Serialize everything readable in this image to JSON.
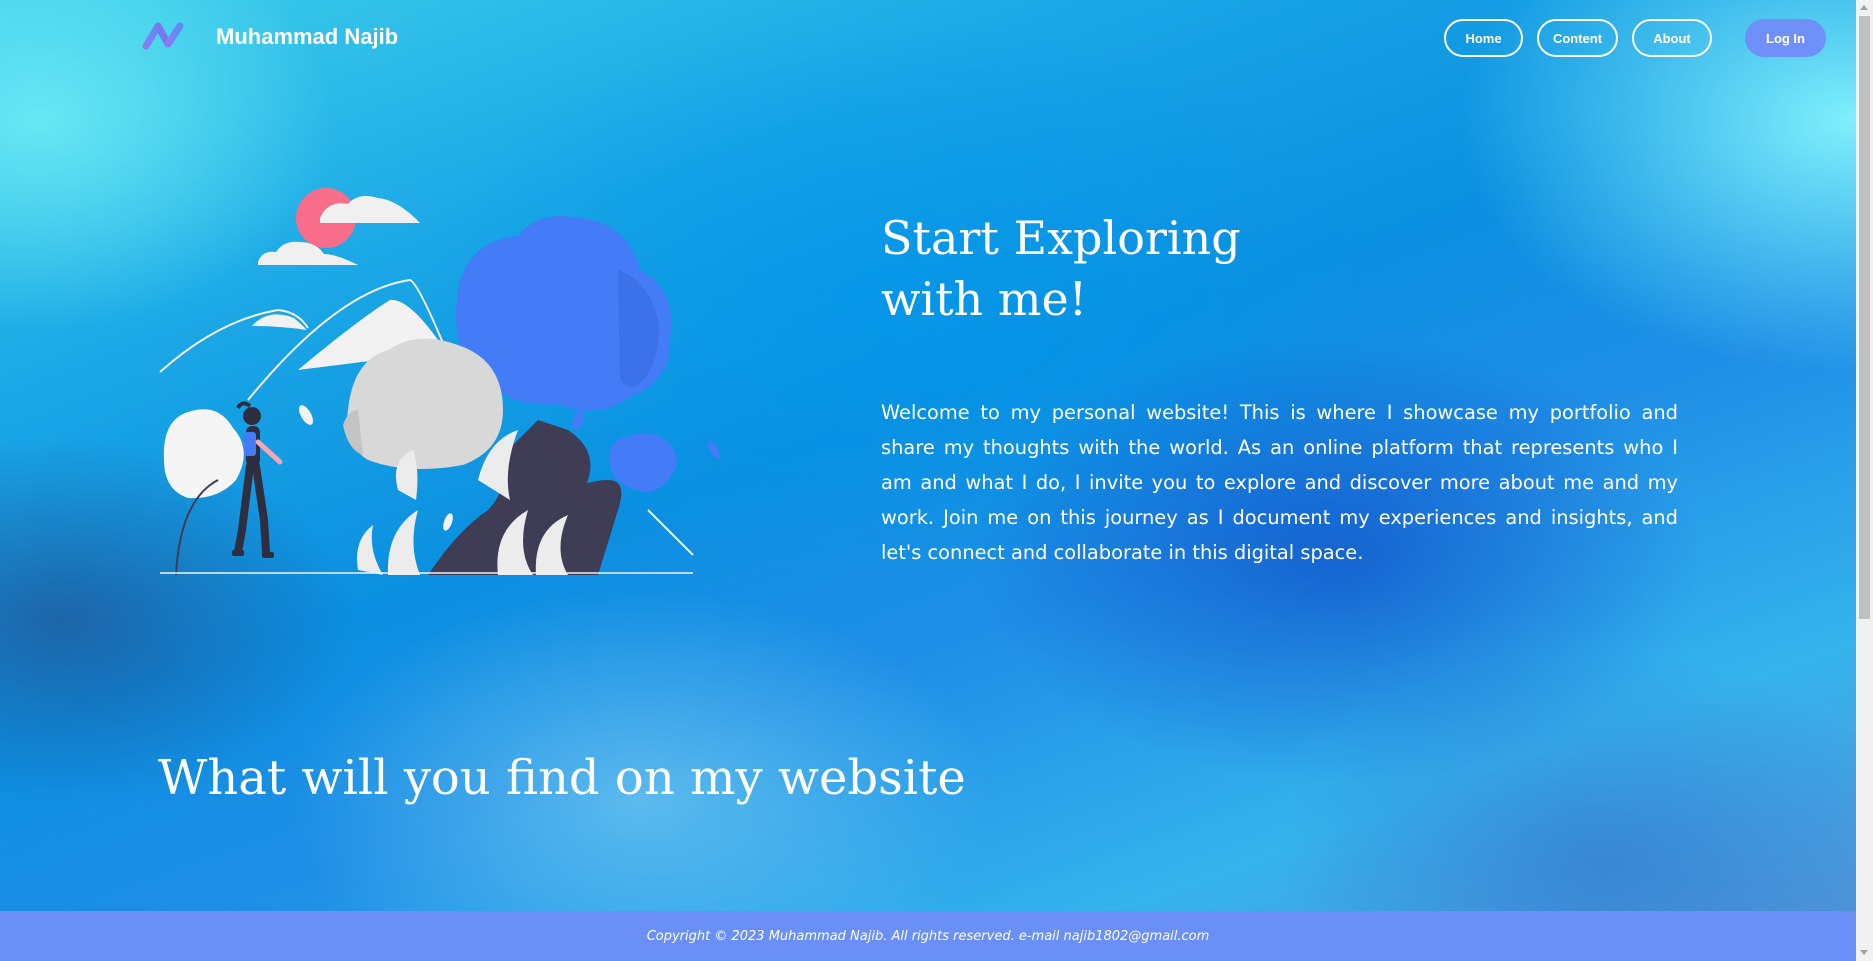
{
  "header": {
    "brand_name": "Muhammad Najib",
    "logo_icon": "n-logo-icon",
    "nav": [
      {
        "label": "Home"
      },
      {
        "label": "Content"
      },
      {
        "label": "About"
      }
    ],
    "login_label": "Log In"
  },
  "hero": {
    "title_line1": "Start Exploring",
    "title_line2": "with me!",
    "text": "Welcome to my personal website! This is where I showcase my portfolio and share my thoughts with the world. As an online platform that represents who I am and what I do, I invite you to explore and discover more about me and my work. Join me on this journey as I document my experiences and insights, and let's connect and collaborate in this digital space.",
    "illustration": "hiker-forest-illustration"
  },
  "section": {
    "title": "What will you find on my website"
  },
  "footer": {
    "text": "Copyright © 2023 Muhammad Najib. All rights reserved. e-mail najib1802@gmail.com"
  },
  "colors": {
    "accent": "#6f8ff9",
    "footer_bg": "#6a90f7",
    "text": "#ffffff"
  }
}
